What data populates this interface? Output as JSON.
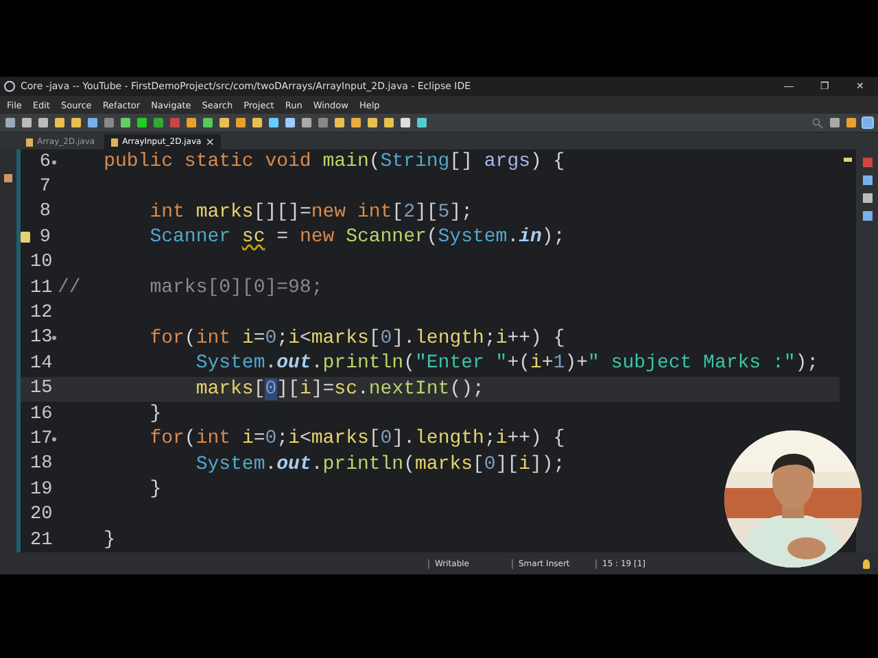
{
  "window": {
    "title": "Core -java -- YouTube - FirstDemoProject/src/com/twoDArrays/ArrayInput_2D.java - Eclipse IDE",
    "controls": [
      "—",
      "❐",
      "✕"
    ]
  },
  "menu": [
    "File",
    "Edit",
    "Source",
    "Refactor",
    "Navigate",
    "Search",
    "Project",
    "Run",
    "Window",
    "Help"
  ],
  "tabs": [
    {
      "label": "Array_2D.java",
      "selected": false
    },
    {
      "label": "ArrayInput_2D.java",
      "selected": true,
      "close": "×"
    }
  ],
  "editor": {
    "lines": [
      {
        "number": "6",
        "fold": true,
        "warning": false,
        "current": false,
        "tokens": [
          {
            "text": "    public static void ",
            "kind": "kw"
          },
          {
            "text": "main",
            "kind": "method"
          },
          {
            "text": "(",
            "kind": "plain"
          },
          {
            "text": "String",
            "kind": "class"
          },
          {
            "text": "[] ",
            "kind": "plain"
          },
          {
            "text": "args",
            "kind": "param"
          },
          {
            "text": ") {",
            "kind": "plain"
          }
        ]
      },
      {
        "number": "7",
        "fold": false,
        "warning": false,
        "current": false
      },
      {
        "number": "8",
        "fold": false,
        "warning": false,
        "current": false,
        "tokens": [
          {
            "text": "        int ",
            "kind": "kw"
          },
          {
            "text": "marks",
            "kind": "var"
          },
          {
            "text": "[][]=",
            "kind": "plain"
          },
          {
            "text": "new int",
            "kind": "kw"
          },
          {
            "text": "[",
            "kind": "plain"
          },
          {
            "text": "2",
            "kind": "num"
          },
          {
            "text": "][",
            "kind": "plain"
          },
          {
            "text": "5",
            "kind": "num"
          },
          {
            "text": "];",
            "kind": "plain"
          }
        ]
      },
      {
        "number": "9",
        "fold": false,
        "warning": true,
        "current": false,
        "tokens": [
          {
            "text": "        Scanner ",
            "kind": "class"
          },
          {
            "text": "sc",
            "kind": "varwarn"
          },
          {
            "text": " = ",
            "kind": "plain"
          },
          {
            "text": "new ",
            "kind": "kw"
          },
          {
            "text": "Scanner",
            "kind": "method"
          },
          {
            "text": "(",
            "kind": "plain"
          },
          {
            "text": "System",
            "kind": "class"
          },
          {
            "text": ".",
            "kind": "plain"
          },
          {
            "text": "in",
            "kind": "static"
          },
          {
            "text": ");",
            "kind": "plain"
          }
        ]
      },
      {
        "number": "10",
        "fold": false,
        "warning": false,
        "current": false
      },
      {
        "number": "11",
        "fold": false,
        "warning": false,
        "current": false,
        "tokens": [
          {
            "text": "//      marks[0][0]=98;",
            "kind": "comment"
          }
        ]
      },
      {
        "number": "12",
        "fold": false,
        "warning": false,
        "current": false
      },
      {
        "number": "13",
        "fold": true,
        "warning": false,
        "current": false,
        "tokens": [
          {
            "text": "        for",
            "kind": "kw"
          },
          {
            "text": "(",
            "kind": "plain"
          },
          {
            "text": "int ",
            "kind": "kw"
          },
          {
            "text": "i",
            "kind": "var"
          },
          {
            "text": "=",
            "kind": "plain"
          },
          {
            "text": "0",
            "kind": "num"
          },
          {
            "text": ";",
            "kind": "plain"
          },
          {
            "text": "i",
            "kind": "var"
          },
          {
            "text": "<",
            "kind": "plain"
          },
          {
            "text": "marks",
            "kind": "var"
          },
          {
            "text": "[",
            "kind": "plain"
          },
          {
            "text": "0",
            "kind": "num"
          },
          {
            "text": "].",
            "kind": "plain"
          },
          {
            "text": "length",
            "kind": "var"
          },
          {
            "text": ";",
            "kind": "plain"
          },
          {
            "text": "i",
            "kind": "var"
          },
          {
            "text": "++) {",
            "kind": "plain"
          }
        ]
      },
      {
        "number": "14",
        "fold": false,
        "warning": false,
        "current": false,
        "tokens": [
          {
            "text": "            System",
            "kind": "class"
          },
          {
            "text": ".",
            "kind": "plain"
          },
          {
            "text": "out",
            "kind": "static"
          },
          {
            "text": ".",
            "kind": "plain"
          },
          {
            "text": "println",
            "kind": "method"
          },
          {
            "text": "(",
            "kind": "plain"
          },
          {
            "text": "\"Enter \"",
            "kind": "str"
          },
          {
            "text": "+(",
            "kind": "plain"
          },
          {
            "text": "i",
            "kind": "var"
          },
          {
            "text": "+",
            "kind": "plain"
          },
          {
            "text": "1",
            "kind": "num"
          },
          {
            "text": ")+",
            "kind": "plain"
          },
          {
            "text": "\" subject Marks :\"",
            "kind": "str"
          },
          {
            "text": ");",
            "kind": "plain"
          }
        ]
      },
      {
        "number": "15",
        "fold": false,
        "warning": false,
        "current": true,
        "tokens": [
          {
            "text": "            marks",
            "kind": "var"
          },
          {
            "text": "[",
            "kind": "plain"
          },
          {
            "text": "0",
            "kind": "numsel"
          },
          {
            "text": "][",
            "kind": "plain"
          },
          {
            "text": "i",
            "kind": "var"
          },
          {
            "text": "]=",
            "kind": "plain"
          },
          {
            "text": "sc",
            "kind": "var"
          },
          {
            "text": ".",
            "kind": "plain"
          },
          {
            "text": "nextInt",
            "kind": "method"
          },
          {
            "text": "();",
            "kind": "plain"
          }
        ]
      },
      {
        "number": "16",
        "fold": false,
        "warning": false,
        "current": false,
        "tokens": [
          {
            "text": "        }",
            "kind": "plain"
          }
        ]
      },
      {
        "number": "17",
        "fold": true,
        "warning": false,
        "current": false,
        "tokens": [
          {
            "text": "        for",
            "kind": "kw"
          },
          {
            "text": "(",
            "kind": "plain"
          },
          {
            "text": "int ",
            "kind": "kw"
          },
          {
            "text": "i",
            "kind": "var"
          },
          {
            "text": "=",
            "kind": "plain"
          },
          {
            "text": "0",
            "kind": "num"
          },
          {
            "text": ";",
            "kind": "plain"
          },
          {
            "text": "i",
            "kind": "var"
          },
          {
            "text": "<",
            "kind": "plain"
          },
          {
            "text": "marks",
            "kind": "var"
          },
          {
            "text": "[",
            "kind": "plain"
          },
          {
            "text": "0",
            "kind": "num"
          },
          {
            "text": "].",
            "kind": "plain"
          },
          {
            "text": "length",
            "kind": "var"
          },
          {
            "text": ";",
            "kind": "plain"
          },
          {
            "text": "i",
            "kind": "var"
          },
          {
            "text": "++) {",
            "kind": "plain"
          }
        ]
      },
      {
        "number": "18",
        "fold": false,
        "warning": false,
        "current": false,
        "tokens": [
          {
            "text": "            System",
            "kind": "class"
          },
          {
            "text": ".",
            "kind": "plain"
          },
          {
            "text": "out",
            "kind": "static"
          },
          {
            "text": ".",
            "kind": "plain"
          },
          {
            "text": "println",
            "kind": "method"
          },
          {
            "text": "(",
            "kind": "plain"
          },
          {
            "text": "marks",
            "kind": "var"
          },
          {
            "text": "[",
            "kind": "plain"
          },
          {
            "text": "0",
            "kind": "num"
          },
          {
            "text": "][",
            "kind": "plain"
          },
          {
            "text": "i",
            "kind": "var"
          },
          {
            "text": "]);",
            "kind": "plain"
          }
        ]
      },
      {
        "number": "19",
        "fold": false,
        "warning": false,
        "current": false,
        "tokens": [
          {
            "text": "        }",
            "kind": "plain"
          }
        ]
      },
      {
        "number": "20",
        "fold": false,
        "warning": false,
        "current": false
      },
      {
        "number": "21",
        "fold": false,
        "warning": false,
        "current": false,
        "tokens": [
          {
            "text": "    }",
            "kind": "plain"
          }
        ]
      }
    ]
  },
  "status_bar": [
    "Writable",
    "Smart Insert",
    "15 : 19 [1]"
  ]
}
